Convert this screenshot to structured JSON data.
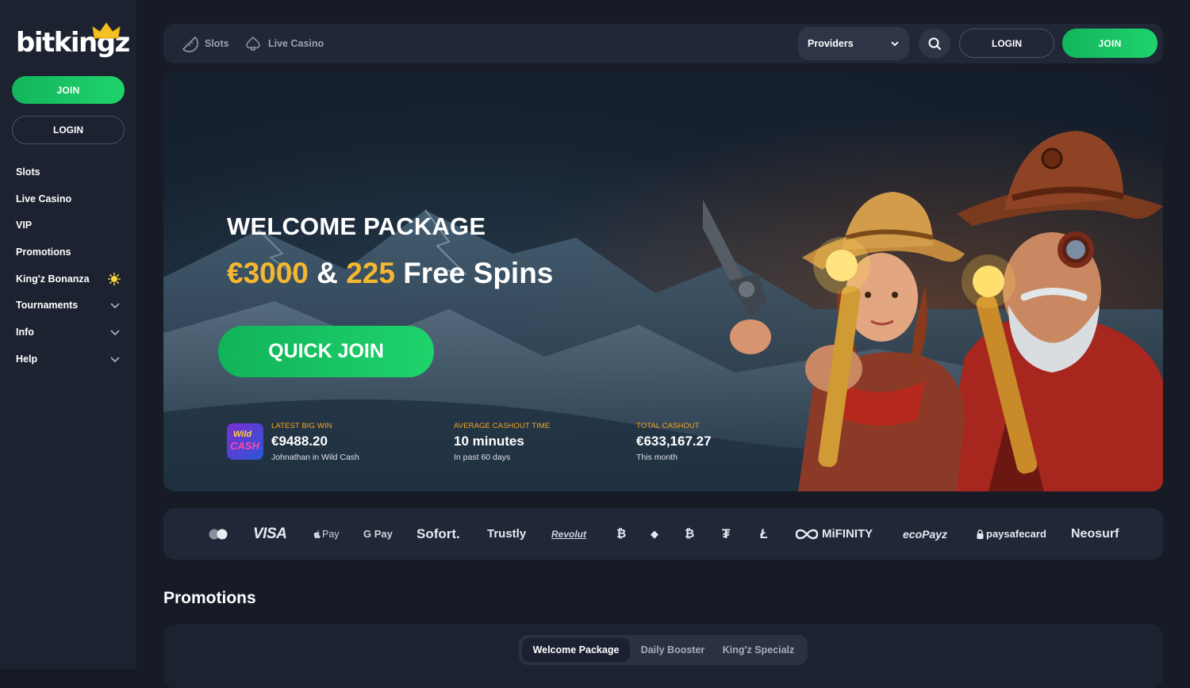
{
  "brand": {
    "logo_text": "bitkingz"
  },
  "sidebar": {
    "join_label": "JOIN",
    "login_label": "LOGIN",
    "items": [
      {
        "label": "Slots"
      },
      {
        "label": "Live Casino"
      },
      {
        "label": "VIP"
      },
      {
        "label": "Promotions"
      },
      {
        "label": "King'z Bonanza",
        "icon": "sun-icon"
      },
      {
        "label": "Tournaments",
        "icon": "chevron-down-icon"
      },
      {
        "label": "Info",
        "icon": "chevron-down-icon"
      },
      {
        "label": "Help",
        "icon": "chevron-down-icon"
      }
    ]
  },
  "topbar": {
    "slots_label": "Slots",
    "live_casino_label": "Live Casino",
    "providers_label": "Providers",
    "login_label": "LOGIN",
    "join_label": "JOIN"
  },
  "hero": {
    "title": "WELCOME PACKAGE",
    "amount": "€3000",
    "connector": "&",
    "spins_count": "225",
    "spins_label": "Free Spins",
    "cta_label": "QUICK JOIN",
    "stats": [
      {
        "label": "LATEST BIG WIN",
        "value": "€9488.20",
        "sub": "Johnathan in Wild Cash",
        "thumb_line1": "Wild",
        "thumb_line2": "CASH"
      },
      {
        "label": "AVERAGE CASHOUT TIME",
        "value": "10 minutes",
        "sub": "In past 60 days"
      },
      {
        "label": "TOTAL CASHOUT",
        "value": "€633,167.27",
        "sub": "This month"
      }
    ]
  },
  "payments": {
    "visa": "VISA",
    "apple_pay": "Pay",
    "google_pay": "G Pay",
    "sofort": "Sofort.",
    "trustly": "Trustly",
    "revolut": "Revolut",
    "bitcoin": "₿",
    "ethereum": "◆",
    "bitcoin_cash": "₿",
    "tether": "₮",
    "litecoin": "Ł",
    "mifinity": "MiFINITY",
    "ecopayz": "ecoPayz",
    "paysafecard": "paysafecard",
    "neosurf": "Neosurf"
  },
  "promotions": {
    "title": "Promotions",
    "tabs": [
      {
        "label": "Welcome Package",
        "active": true
      },
      {
        "label": "Daily Booster"
      },
      {
        "label": "King'z Specialz"
      }
    ]
  },
  "colors": {
    "accent_green": "#1fd36b",
    "gold": "#f5b730",
    "stat_label": "#f5a623",
    "bg": "#161b26"
  }
}
